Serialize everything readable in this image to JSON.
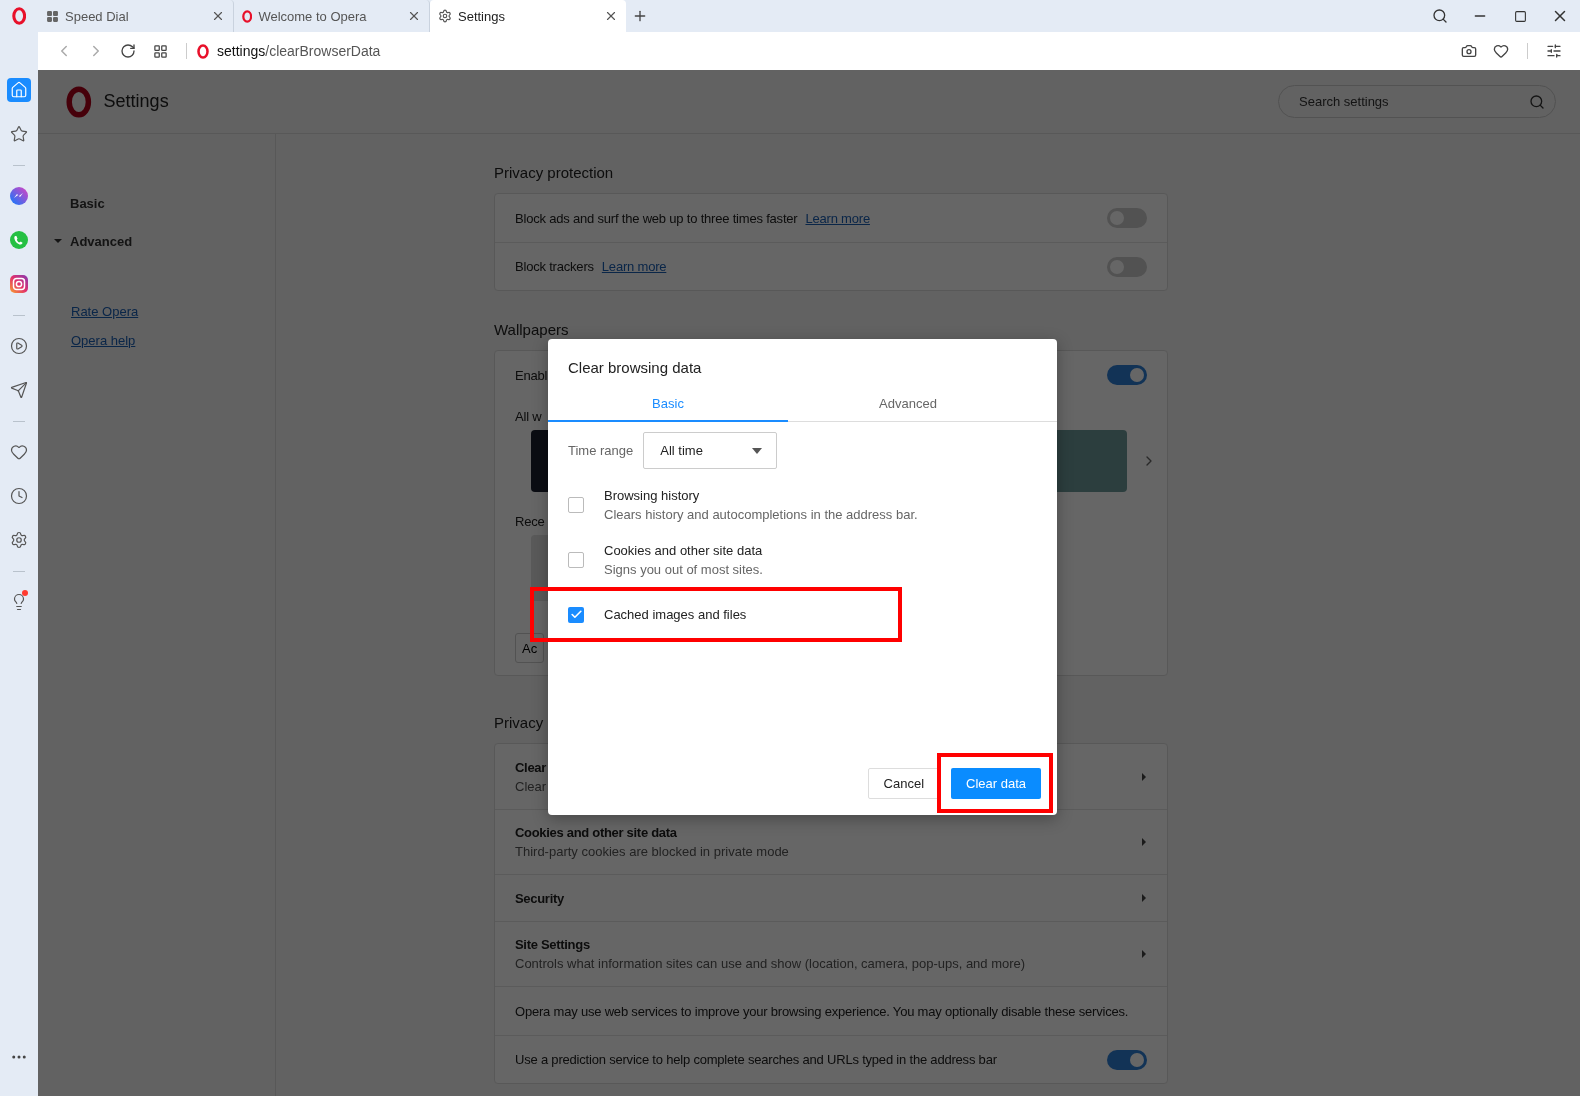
{
  "tabs": [
    {
      "label": "Speed Dial",
      "kind": "speed-dial",
      "selected": false
    },
    {
      "label": "Welcome to Opera",
      "kind": "opera",
      "selected": false
    },
    {
      "label": "Settings",
      "kind": "settings",
      "selected": true
    }
  ],
  "address_bar": {
    "host": "settings",
    "path": "/clearBrowserData"
  },
  "sidebar": {
    "items": [
      {
        "kind": "home",
        "selected": true
      },
      {
        "kind": "star",
        "selected": false
      },
      {
        "kind": "divider"
      },
      {
        "kind": "chat",
        "selected": false
      },
      {
        "kind": "phone",
        "selected": false
      },
      {
        "kind": "photo",
        "selected": false
      },
      {
        "kind": "divider"
      },
      {
        "kind": "play",
        "selected": false
      },
      {
        "kind": "send",
        "selected": false
      },
      {
        "kind": "divider"
      },
      {
        "kind": "heart",
        "selected": false
      },
      {
        "kind": "clock",
        "selected": false
      },
      {
        "kind": "gear",
        "selected": false
      },
      {
        "kind": "divider"
      },
      {
        "kind": "bulb",
        "selected": false,
        "badge": true
      }
    ]
  },
  "settings": {
    "title": "Settings",
    "search": {
      "placeholder": "Search settings"
    },
    "nav": [
      {
        "label": "Basic"
      },
      {
        "label": "Advanced",
        "expanded": true
      }
    ],
    "links": [
      "Rate Opera",
      "Opera help"
    ],
    "privacy_protection": {
      "title": "Privacy protection",
      "rows": [
        {
          "title": "Block ads and surf the web up to three times faster",
          "link": "Learn more",
          "on": false
        },
        {
          "title": "Block trackers",
          "link": "Learn more",
          "on": false
        }
      ]
    },
    "wallpapers": {
      "title": "Wallpapers",
      "enable_label": "Enabl",
      "enabled": true,
      "all_label": "All w",
      "recent_label": "Rece",
      "add_button": "Ac"
    },
    "privacy": {
      "title": "Privacy",
      "rows": [
        {
          "kind": "link",
          "title": "Clear",
          "subtitle": "Clear"
        },
        {
          "kind": "link",
          "title": "Cookies and other site data",
          "subtitle": "Third-party cookies are blocked in private mode"
        },
        {
          "kind": "link",
          "title": "Security"
        },
        {
          "kind": "link",
          "title": "Site Settings",
          "subtitle": "Controls what information sites can use and show (location, camera, pop-ups, and more)"
        },
        {
          "kind": "text",
          "title": "Opera may use web services to improve your browsing experience. You may optionally disable these services."
        },
        {
          "kind": "toggle",
          "title": "Use a prediction service to help complete searches and URLs typed in the address bar",
          "on": true
        }
      ]
    }
  },
  "dialog": {
    "title": "Clear browsing data",
    "tabs": [
      {
        "label": "Basic",
        "selected": true
      },
      {
        "label": "Advanced",
        "selected": false
      }
    ],
    "time_range": {
      "label": "Time range",
      "value": "All time"
    },
    "items": [
      {
        "title": "Browsing history",
        "subtitle": "Clears history and autocompletions in the address bar.",
        "checked": false,
        "highlighted": false
      },
      {
        "title": "Cookies and other site data",
        "subtitle": "Signs you out of most sites.",
        "checked": false,
        "highlighted": false
      },
      {
        "title": "Cached images and files",
        "checked": true,
        "highlighted": true
      }
    ],
    "buttons": [
      {
        "label": "Cancel",
        "kind": "secondary",
        "highlighted": false
      },
      {
        "label": "Clear data",
        "kind": "primary",
        "highlighted": true
      }
    ]
  }
}
